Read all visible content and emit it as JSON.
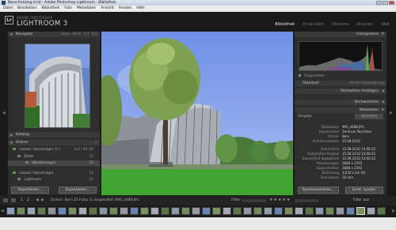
{
  "window": {
    "title": "Neue Katalog.lrcat - Adobe Photoshop Lightroom - Bibliothek"
  },
  "menu": [
    "Datei",
    "Bearbeiten",
    "Bibliothek",
    "Foto",
    "Metadaten",
    "Ansicht",
    "Fenster",
    "Hilfe"
  ],
  "brand": {
    "logo": "Lr",
    "small": "ADOBE PHOTOSHOP",
    "big": "LIGHTROOM 3"
  },
  "modules": [
    "Bibliothek",
    "Entwickeln",
    "Diashow",
    "Drucken",
    "Web"
  ],
  "left_panel": {
    "navigator": {
      "title": "Navigator",
      "zoom": [
        "Einp.",
        "Ausf.",
        "1:1",
        "3:1"
      ]
    },
    "catalog": {
      "title": "Katalog"
    },
    "folders": {
      "title": "Ordner",
      "volume": "Lokaler Datenträger (C:)",
      "volume_info": "0,0 / 60 GB",
      "items": [
        {
          "label": "Bilder",
          "count": "25"
        },
        {
          "label": "Wanderungen",
          "count": "25"
        },
        {
          "label": "Lokaler Datenträger",
          "count": "11"
        },
        {
          "label": "Lightroom",
          "count": "11"
        }
      ]
    },
    "buttons": {
      "import": "Importieren...",
      "export": "Exportieren..."
    }
  },
  "right_panel": {
    "histogram": {
      "title": "Histogramm"
    },
    "original": "Originalfoto",
    "quick_develop": {
      "title": "Ad-hoc-Entwicklung",
      "preset": "Standard"
    },
    "keywording": {
      "title": "Stichwörter festlegen"
    },
    "keyword_list": {
      "title": "Stichwortliste"
    },
    "metadata": {
      "title": "Metadaten",
      "mode": "Standard",
      "preset_label": "Vorgabe",
      "fields": [
        {
          "k": "Dateiname",
          "v": "IMG_4488.JPG"
        },
        {
          "k": "Kopienname",
          "v": "Zentrum Paul Klee"
        },
        {
          "k": "Ordner",
          "v": "Bern"
        },
        {
          "k": "Aufnahmedatum",
          "v": "15.08.2010"
        },
        {
          "k": "Datum/Zeit",
          "v": "15.08.2010 14:08:32"
        },
        {
          "k": "Datum/Zeit Original",
          "v": "15.08.2010 14:08:32"
        },
        {
          "k": "Datum/Zeit digitalisiert",
          "v": "15.08.2010 14:08:32"
        },
        {
          "k": "Abmessungen",
          "v": "3888 x 2592"
        },
        {
          "k": "Zugeschnitten",
          "v": "3888 x 2592"
        },
        {
          "k": "Belichtung",
          "v": "1/250 s bei f/8"
        },
        {
          "k": "Brennweite",
          "v": "18 mm"
        }
      ]
    },
    "buttons": {
      "sync": "Synchronisieren...",
      "sync_settings": "Einst. synchr."
    }
  },
  "filmstrip": {
    "page1": "1",
    "page2": "2",
    "path_info": "Ordner: Bern  25 Fotos /1 ausgewählt  /IMG_4488.JPG",
    "filter_label": "Filter:",
    "filter_value": "Filter aus"
  },
  "colors": {
    "panel_bg": "#2e2e2e",
    "header_bg": "#191919",
    "accent_text": "#e8e8e8",
    "sky": "#7898ea"
  }
}
